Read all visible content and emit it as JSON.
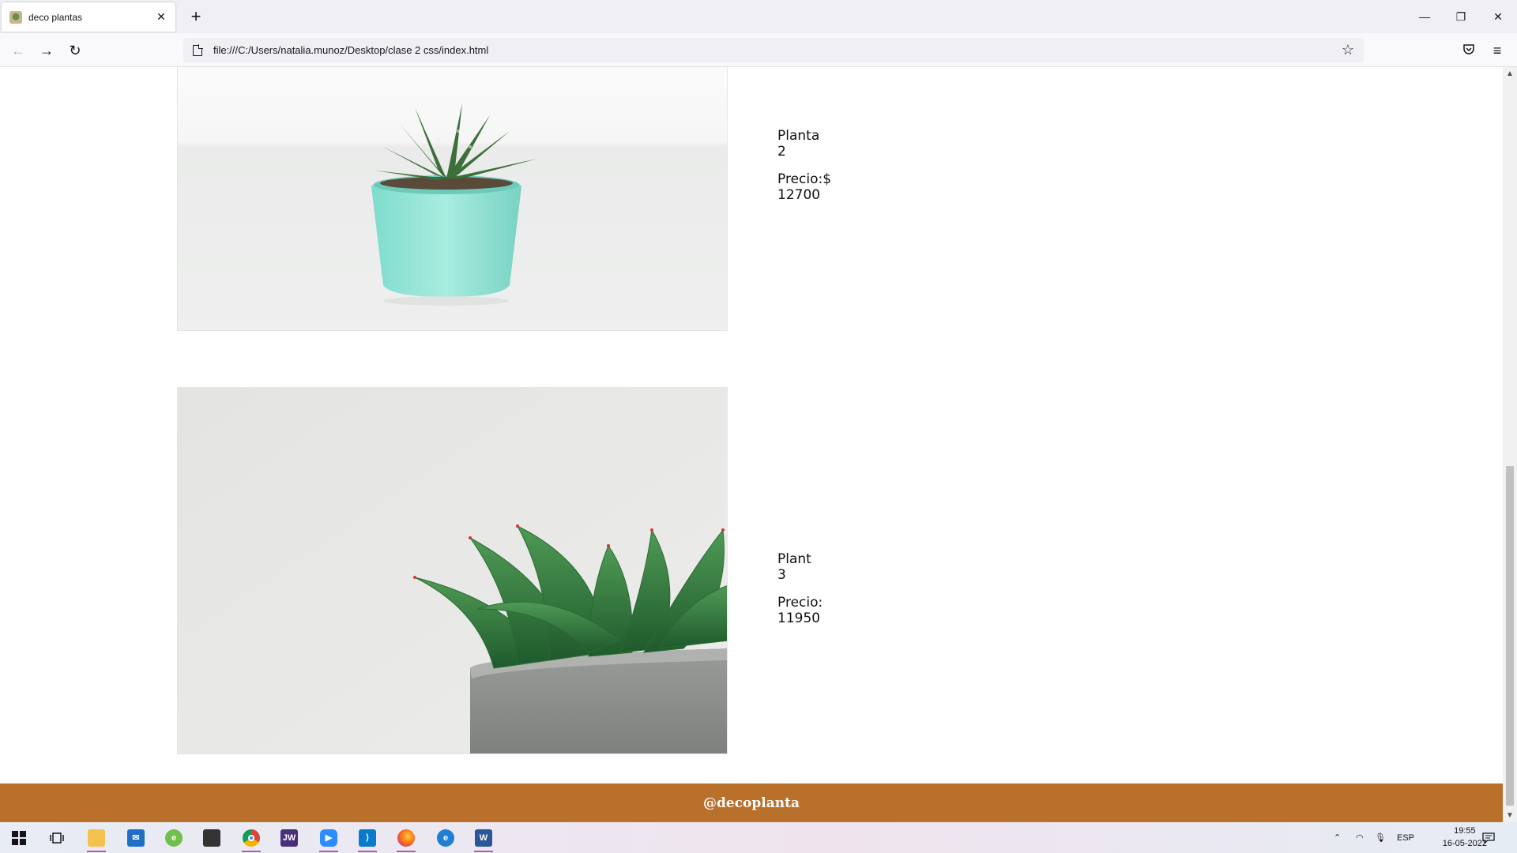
{
  "browser": {
    "tab_title": "deco plantas",
    "tab_close": "✕",
    "new_tab": "+",
    "url": "file:///C:/Users/natalia.munoz/Desktop/clase 2 css/index.html",
    "window_controls": {
      "minimize": "—",
      "restore": "❐",
      "close": "✕"
    },
    "nav": {
      "back": "←",
      "forward": "→",
      "reload": "↻"
    }
  },
  "products": [
    {
      "name": "Planta 2",
      "price": "Precio:$ 12700",
      "image_icon": "succulent-teal-pot-image"
    },
    {
      "name": "Plant 3",
      "price": "Precio: 11950",
      "image_icon": "succulent-concrete-pot-image"
    }
  ],
  "footer": {
    "handle": "@decoplanta",
    "color": "#b8702a"
  },
  "taskbar": {
    "apps": [
      "windows-start",
      "task-view",
      "file-explorer",
      "mail",
      "edge-legacy",
      "store",
      "chrome",
      "jw-library",
      "zoom",
      "vscode",
      "firefox",
      "edge",
      "word"
    ],
    "language": "ESP",
    "time": "19:55",
    "date": "16-05-2022"
  }
}
